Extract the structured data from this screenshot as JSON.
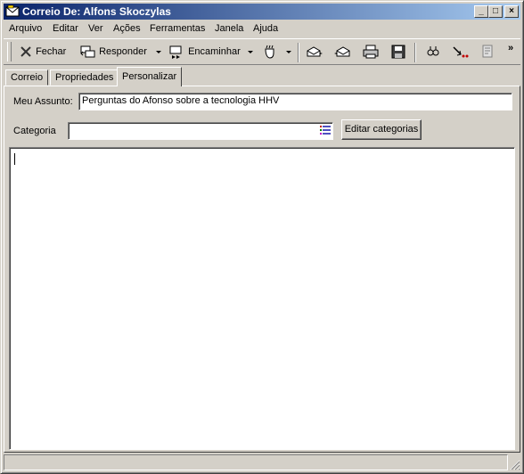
{
  "window": {
    "title": "Correio De: Alfons Skoczylas"
  },
  "title_buttons": {
    "minimize": "_",
    "maximize": "□",
    "close": "×"
  },
  "menu": [
    "Arquivo",
    "Editar",
    "Ver",
    "Ações",
    "Ferramentas",
    "Janela",
    "Ajuda"
  ],
  "toolbar": {
    "close_label": "Fechar",
    "reply_label": "Responder",
    "forward_label": "Encaminhar",
    "overflow": "»"
  },
  "tabs": [
    "Correio",
    "Propriedades",
    "Personalizar"
  ],
  "active_tab": "Personalizar",
  "form": {
    "subject_label": "Meu Assunto:",
    "subject_value": "Perguntas do Afonso sobre a tecnologia HHV",
    "category_label": "Categoria",
    "category_value": "",
    "edit_categories_button": "Editar categorias"
  },
  "notes": {
    "text": ""
  },
  "status": {
    "text": ""
  }
}
